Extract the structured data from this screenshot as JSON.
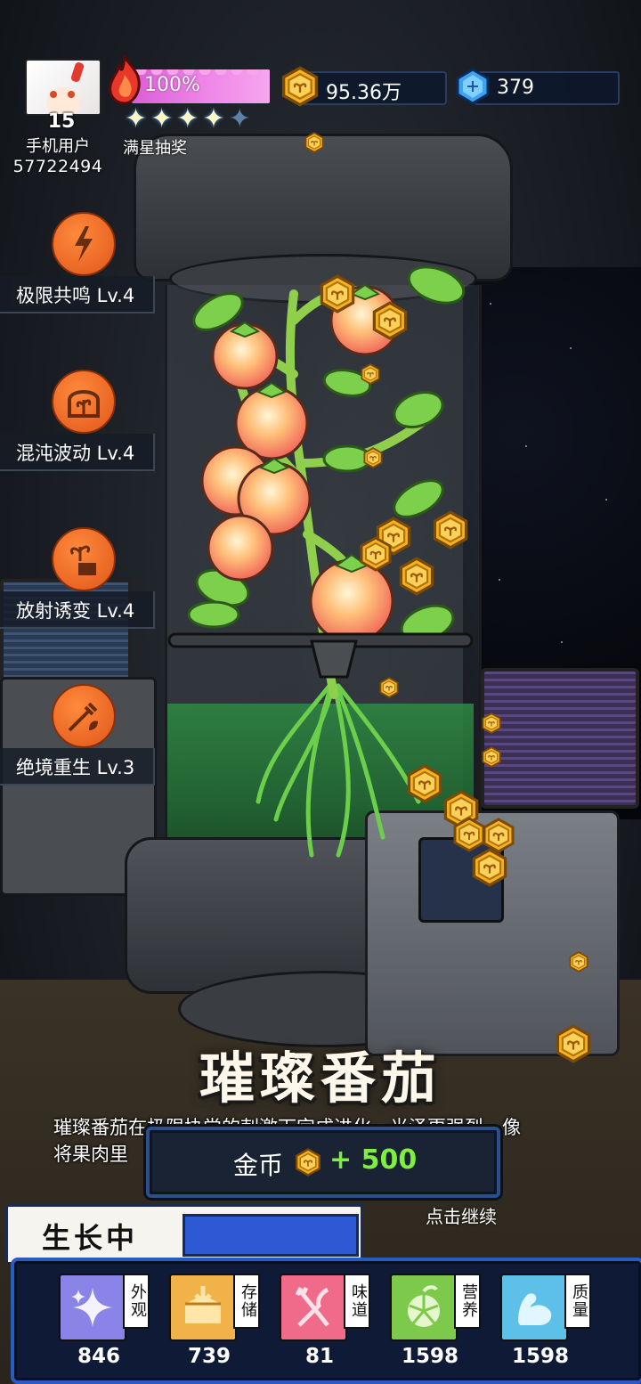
{
  "player": {
    "level": "15",
    "name": "手机用户",
    "id": "57722494"
  },
  "energy": {
    "percent_text": "100%",
    "stars_filled": 4,
    "stars_total": 5,
    "full_star_draw_label": "满星抽奖"
  },
  "currency": {
    "coins": "95.36万",
    "gems": "379"
  },
  "skills": [
    {
      "label": "极限共鸣 Lv.4",
      "icon": "lightning-plant-icon"
    },
    {
      "label": "混沌波动 Lv.4",
      "icon": "plant-dome-icon"
    },
    {
      "label": "放射诱变 Lv.4",
      "icon": "plant-box-icon"
    },
    {
      "label": "绝境重生 Lv.3",
      "icon": "syringe-plant-icon"
    }
  ],
  "result": {
    "title": "璀璨番茄",
    "desc_line1": "璀璨番茄在极限协尝的刺激下完成进化，光泽更强烈，像",
    "desc_line2": "将果肉里",
    "reward_label": "金币",
    "reward_value": "+ 500",
    "continue_hint": "点击继续"
  },
  "growth": {
    "label": "生长中",
    "progress": 1.0
  },
  "stats": [
    {
      "tag": "外观",
      "value": "846",
      "icon": "sparkle-icon",
      "color": "#8a84e8"
    },
    {
      "tag": "存储",
      "value": "739",
      "icon": "box-icon",
      "color": "#f2b24a"
    },
    {
      "tag": "味道",
      "value": "81",
      "icon": "fork-knife-icon",
      "color": "#f06a8a"
    },
    {
      "tag": "营养",
      "value": "1598",
      "icon": "citrus-icon",
      "color": "#7cc94c"
    },
    {
      "tag": "质量",
      "value": "1598",
      "icon": "muscle-icon",
      "color": "#5cc0e8"
    }
  ],
  "colors": {
    "skill_orange": "#e8611e",
    "reward_green": "#7cf03c",
    "panel_blue": "#2a5bbf",
    "energy_pink": "#e36fe0"
  }
}
